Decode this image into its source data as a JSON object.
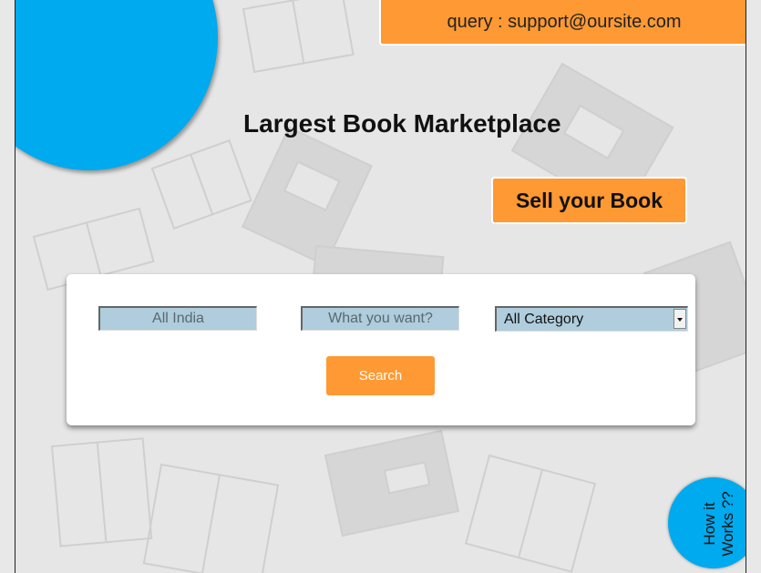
{
  "header": {
    "query_text": "query : support@oursite.com",
    "title": "Largest Book Marketplace"
  },
  "sell_button": {
    "label": "Sell your Book"
  },
  "search": {
    "location_placeholder": "All India",
    "query_placeholder": "What you want?",
    "category_selected": "All Category",
    "button_label": "Search"
  },
  "how_it_works": {
    "label": "How it Works ??"
  },
  "colors": {
    "accent_orange": "#ff9933",
    "accent_blue": "#00aaee",
    "field_bg": "#afcddc"
  },
  "icons": [
    "book-icon",
    "chevron-down-icon"
  ]
}
